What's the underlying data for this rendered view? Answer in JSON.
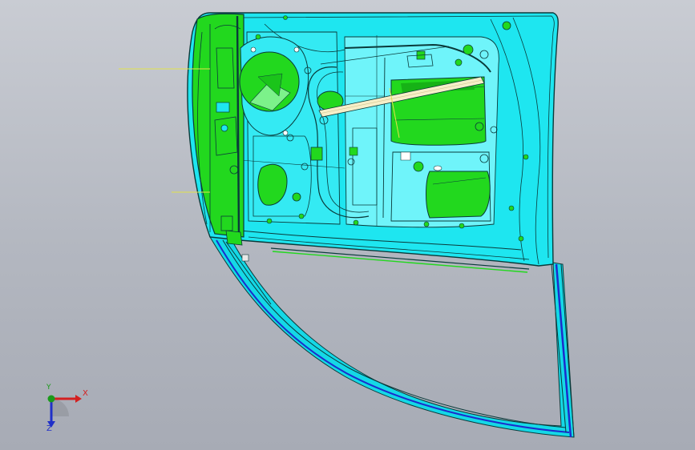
{
  "viewport": {
    "background_top": "#c9ccd3",
    "background_bottom": "#a7abb5"
  },
  "model": {
    "name_icon": "car-door-inner-panel-model",
    "colors": {
      "panel_cyan": "#1ee6f0",
      "panel_cyan_light": "#6ff4fa",
      "reinforcement_green": "#22d81e",
      "frame_blue": "#1c2ccc",
      "edge_dark": "#0a3a3a",
      "leader_line": "#e2e24a"
    }
  },
  "triad": {
    "icon": "coordinate-axis-triad-icon",
    "x_label": "X",
    "y_label": "Y",
    "z_label": "Z",
    "x_color": "#d42020",
    "y_color": "#1a9a1a",
    "z_color": "#2030c8"
  }
}
